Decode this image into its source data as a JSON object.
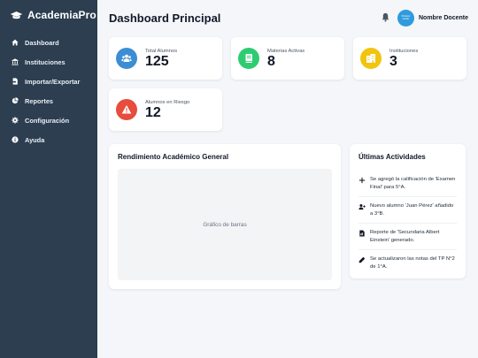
{
  "app": {
    "brand": "AcademiaPro"
  },
  "sidebar": {
    "items": [
      {
        "label": "Dashboard",
        "icon": "home-icon"
      },
      {
        "label": "Instituciones",
        "icon": "institution-icon"
      },
      {
        "label": "Importar/Exportar",
        "icon": "file-import-icon"
      },
      {
        "label": "Reportes",
        "icon": "pie-chart-icon"
      },
      {
        "label": "Configuración",
        "icon": "gear-icon"
      },
      {
        "label": "Ayuda",
        "icon": "info-icon"
      }
    ]
  },
  "header": {
    "title": "Dashboard Principal",
    "user_name": "Nombre Docente",
    "avatar_text_line1": "Profesor",
    "avatar_text_line2": "Avatar"
  },
  "stats": [
    {
      "label": "Total Alumnos",
      "value": "125",
      "color": "#3b8ed4",
      "icon": "users-icon"
    },
    {
      "label": "Materias Activas",
      "value": "8",
      "color": "#2ecc71",
      "icon": "book-icon"
    },
    {
      "label": "Instituciones",
      "value": "3",
      "color": "#f1c40f",
      "icon": "building-icon"
    },
    {
      "label": "Alumnos en Riesgo",
      "value": "12",
      "color": "#e74c3c",
      "icon": "warning-icon"
    }
  ],
  "performance": {
    "title": "Rendimiento Académico General",
    "placeholder": "Gráfico de barras"
  },
  "activities": {
    "title": "Últimas Actividades",
    "items": [
      {
        "text": "Se agregó la calificación de 'Examen Final' para 5°A.",
        "icon": "plus-icon"
      },
      {
        "text": "Nuevo alumno 'Juan Pérez' añadido a 3°B.",
        "icon": "user-plus-icon"
      },
      {
        "text": "Reporte de 'Secundaria Albert Einstein' generado.",
        "icon": "file-icon"
      },
      {
        "text": "Se actualizaron las notas del TP N°2 de 1°A.",
        "icon": "pencil-icon"
      }
    ]
  }
}
